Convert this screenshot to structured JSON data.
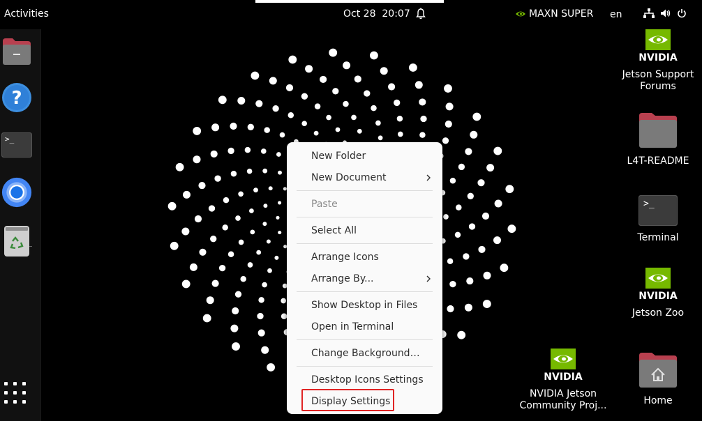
{
  "topbar": {
    "activities": "Activities",
    "date": "Oct 28",
    "time": "20:07",
    "power_mode": "MAXN SUPER",
    "language": "en"
  },
  "dock": {
    "items": [
      {
        "name": "files",
        "icon": "folder-icon"
      },
      {
        "name": "help",
        "icon": "help-icon"
      },
      {
        "name": "terminal",
        "icon": "terminal-icon"
      },
      {
        "name": "chromium",
        "icon": "chromium-icon"
      },
      {
        "name": "trash",
        "icon": "trash-icon"
      }
    ],
    "apps_grid_icon": "apps-grid-icon"
  },
  "context_menu": {
    "items": [
      {
        "label": "New Folder",
        "enabled": true
      },
      {
        "label": "New Document",
        "enabled": true,
        "submenu": true
      },
      {
        "label": "Paste",
        "enabled": false
      },
      {
        "label": "Select All",
        "enabled": true
      },
      {
        "label": "Arrange Icons",
        "enabled": true
      },
      {
        "label": "Arrange By...",
        "enabled": true,
        "submenu": true
      },
      {
        "label": "Show Desktop in Files",
        "enabled": true
      },
      {
        "label": "Open in Terminal",
        "enabled": true
      },
      {
        "label": "Change Background…",
        "enabled": true
      },
      {
        "label": "Desktop Icons Settings",
        "enabled": true
      },
      {
        "label": "Display Settings",
        "enabled": true,
        "highlighted": true
      }
    ]
  },
  "desktop_icons": [
    {
      "label_lines": [
        "Jetson Support",
        "Forums"
      ],
      "logo": "NVIDIA"
    },
    {
      "label_lines": [
        "L4T-README"
      ]
    },
    {
      "label_lines": [
        "Terminal"
      ]
    },
    {
      "label_lines": [
        "Jetson Zoo"
      ],
      "logo": "NVIDIA"
    },
    {
      "label_lines": [
        "NVIDIA Jetson",
        "Community Proj..."
      ],
      "logo": "NVIDIA"
    },
    {
      "label_lines": [
        "Home"
      ]
    }
  ],
  "colors": {
    "nvidia_green": "#76b900",
    "highlight_border": "#e02424",
    "folder_tab": "#b8404f",
    "chromium_blue": "#4285f4"
  }
}
